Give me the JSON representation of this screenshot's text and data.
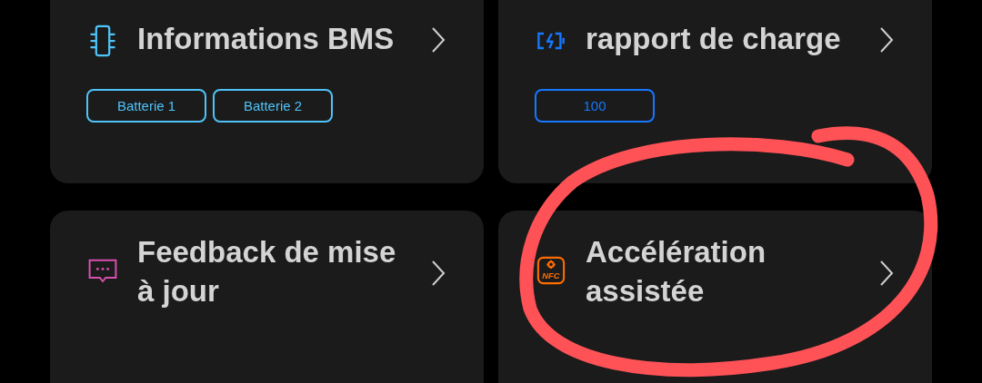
{
  "cards": [
    {
      "kind": "chip",
      "title": "Informations BMS",
      "color": "#4fc3f7",
      "chips": [
        "Batterie 1",
        "Batterie 2"
      ]
    },
    {
      "kind": "battery",
      "title": "rapport de charge",
      "color": "#1677ff",
      "chips": [
        "100"
      ]
    },
    {
      "kind": "message",
      "title": "Feedback de mise à jour",
      "color": "#d94fb0"
    },
    {
      "kind": "nfc",
      "title": "Accélération assistée",
      "color": "#ff6d00",
      "icon_label": "NFC"
    }
  ],
  "annotation": {
    "kind": "circle",
    "color": "#ff5257"
  }
}
